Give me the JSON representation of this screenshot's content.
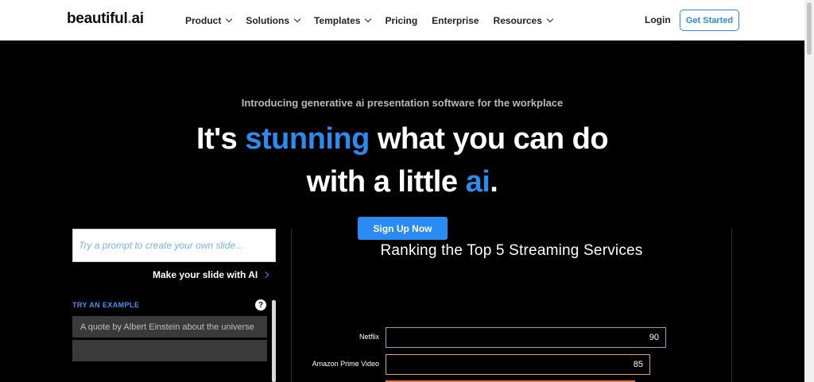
{
  "nav": {
    "logo_text": "beautiful",
    "logo_dot": ".",
    "logo_suffix": "ai",
    "menu": [
      {
        "label": "Product",
        "has_dropdown": true
      },
      {
        "label": "Solutions",
        "has_dropdown": true
      },
      {
        "label": "Templates",
        "has_dropdown": true
      },
      {
        "label": "Pricing",
        "has_dropdown": false
      },
      {
        "label": "Enterprise",
        "has_dropdown": false
      },
      {
        "label": "Resources",
        "has_dropdown": true
      }
    ],
    "login_label": "Login",
    "get_started_label": "Get Started"
  },
  "hero": {
    "intro": "Introducing generative ai presentation software for the workplace",
    "line1_a": "It's ",
    "line1_accent": "stunning",
    "line1_b": " what you can do",
    "line2_a": "with a little ",
    "line2_accent": "ai",
    "line2_b": ".",
    "signup_label": "Sign Up Now"
  },
  "prompt_panel": {
    "placeholder": "Try a prompt to create your own slide...",
    "make_label": "Make your slide with AI",
    "try_label": "TRY AN EXAMPLE",
    "help_glyph": "?",
    "examples": [
      "A quote by Albert Einstein about the universe"
    ]
  },
  "colors": {
    "accent": "#2a8bf2",
    "netflix_bar": "#8ea3bd",
    "amazon_bar": "#e5a04a",
    "third_bar": "#f06a2a"
  },
  "chart_data": {
    "type": "bar",
    "title": "Ranking the Top 5 Streaming Services",
    "categories": [
      "Netflix",
      "Amazon Prime Video"
    ],
    "values": [
      90,
      85
    ],
    "xlim": [
      0,
      100
    ]
  }
}
